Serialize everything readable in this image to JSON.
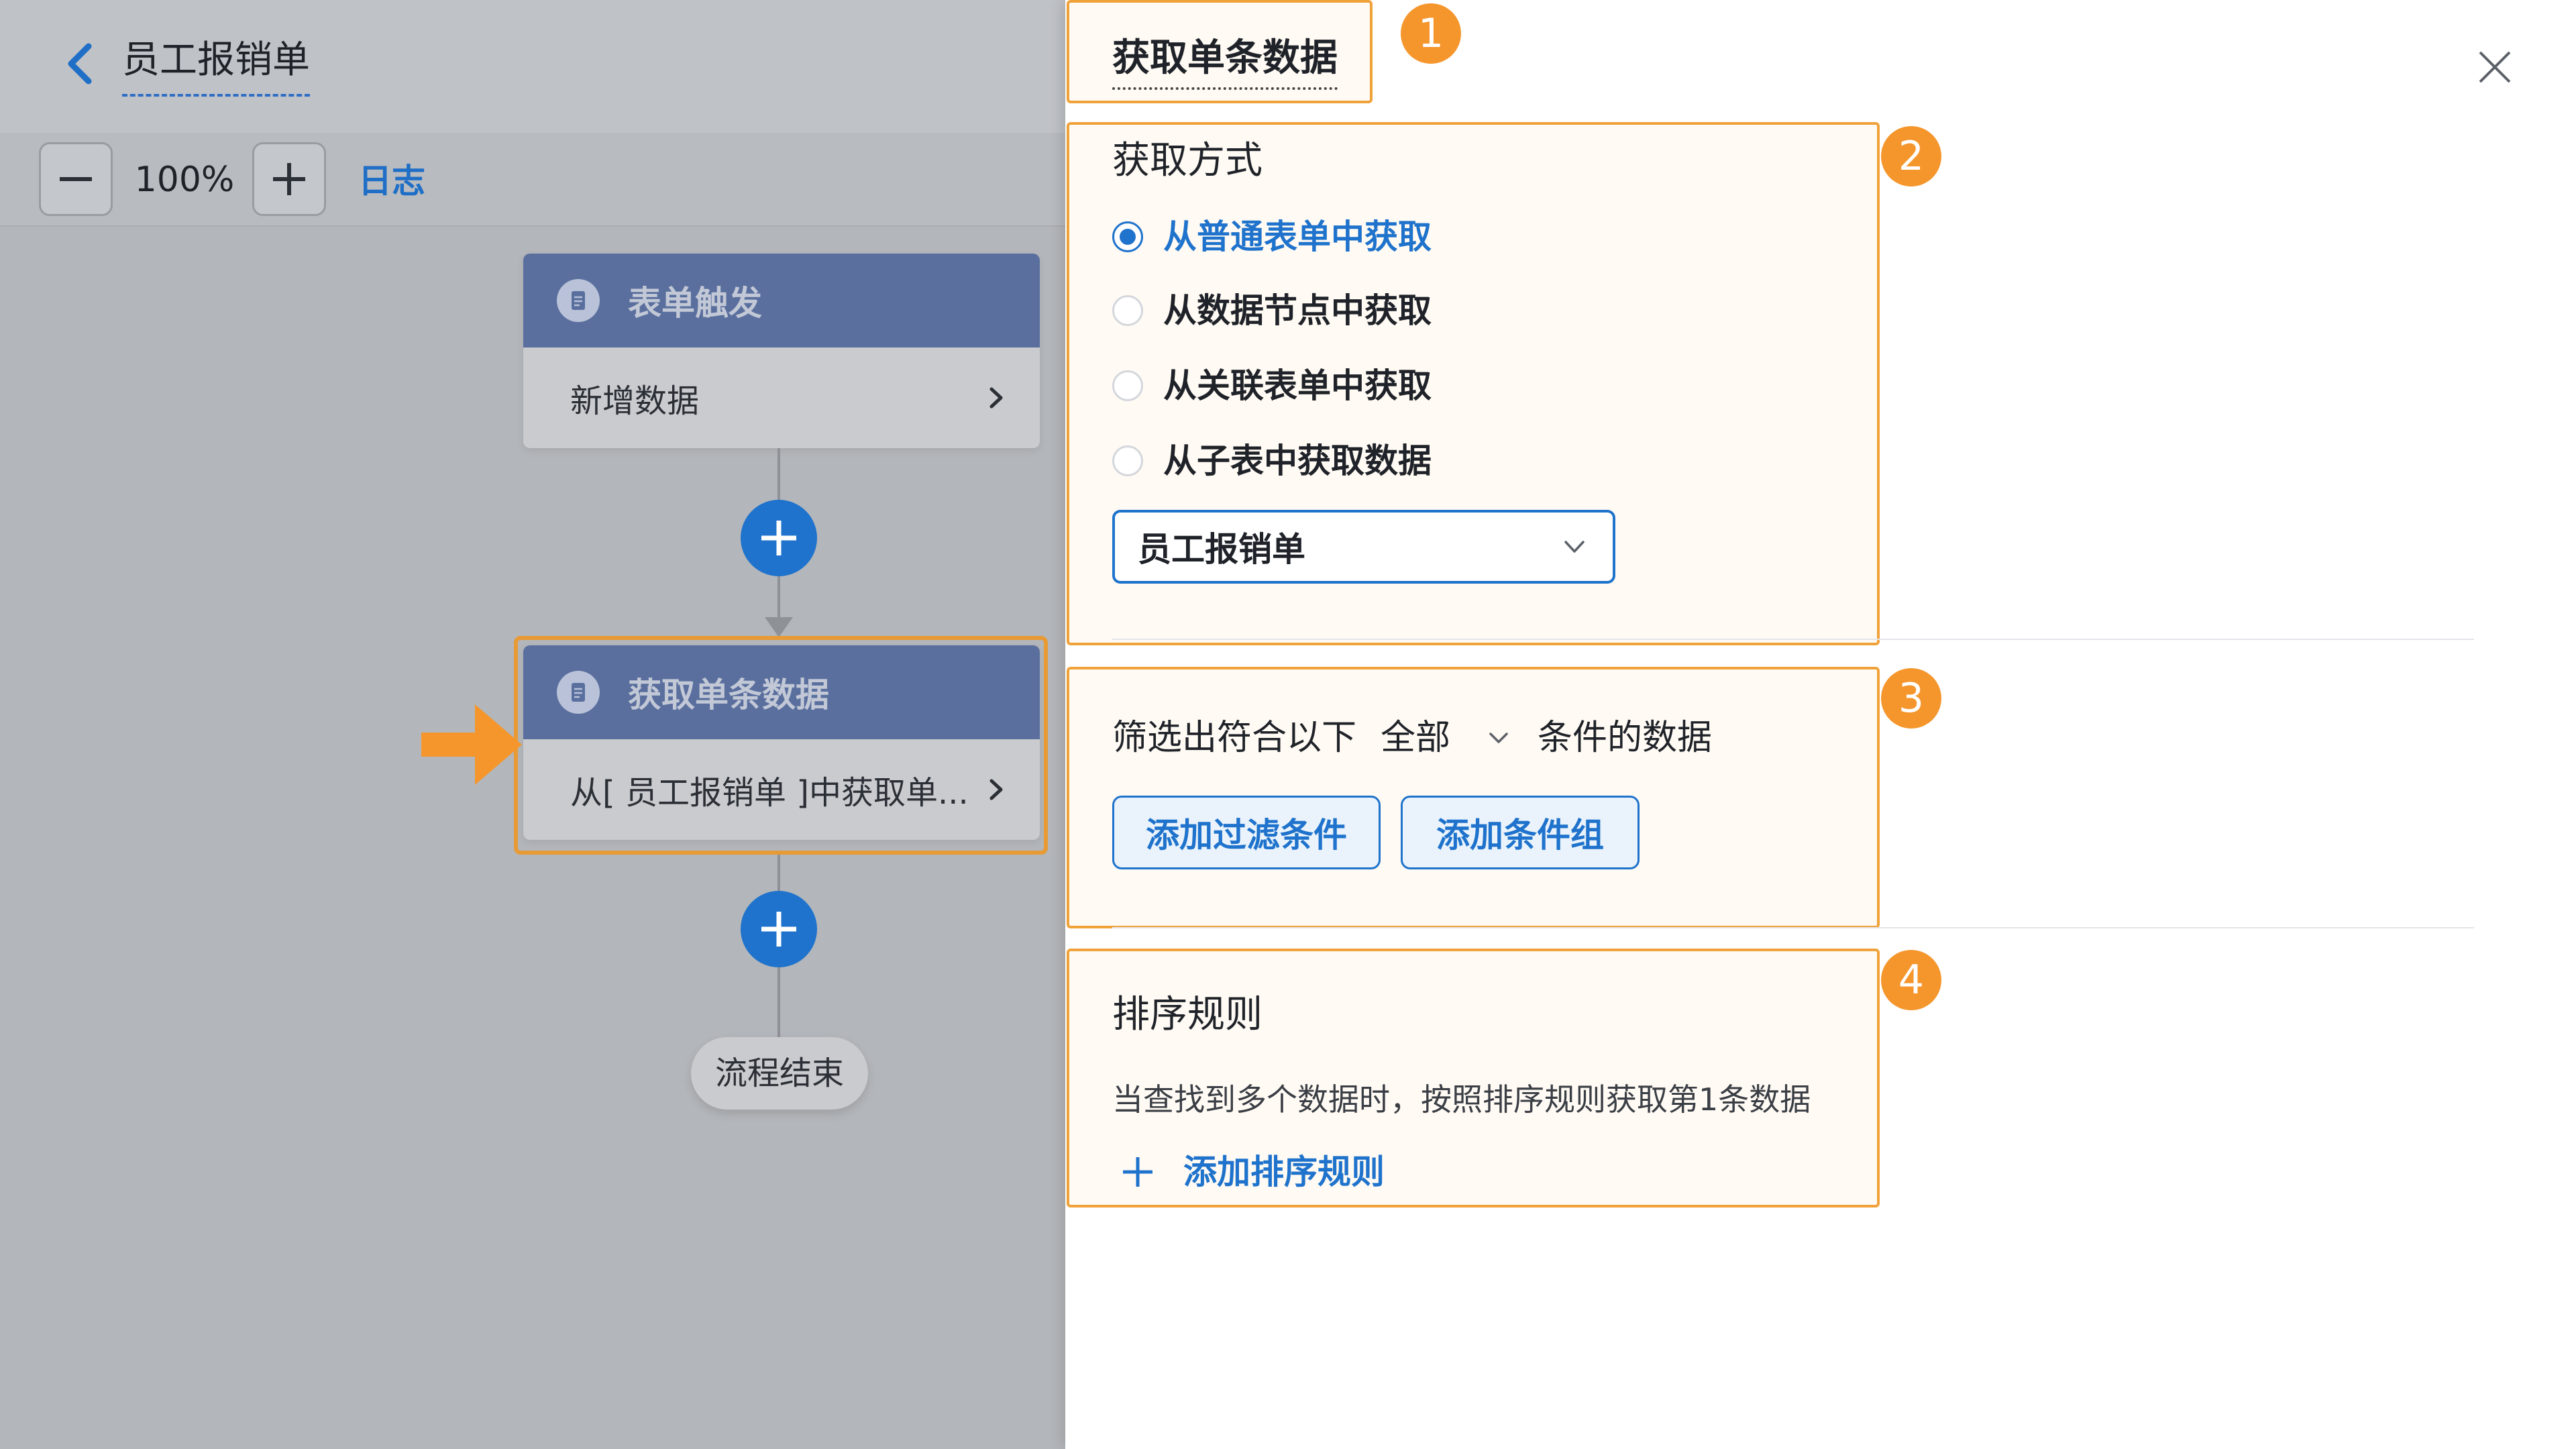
{
  "header": {
    "title": "员工报销单"
  },
  "toolbar": {
    "zoom_level": "100%",
    "log_label": "日志"
  },
  "flow": {
    "trigger_node": {
      "title": "表单触发",
      "body": "新增数据"
    },
    "getone_node": {
      "title": "获取单条数据",
      "body": "从[ 员工报销单 ]中获取单..."
    },
    "end_node": {
      "label": "流程结束"
    }
  },
  "panel": {
    "title": "获取单条数据",
    "method_label": "获取方式",
    "methods": [
      {
        "label": "从普通表单中获取",
        "selected": true
      },
      {
        "label": "从数据节点中获取",
        "selected": false
      },
      {
        "label": "从关联表单中获取",
        "selected": false
      },
      {
        "label": "从子表中获取数据",
        "selected": false
      }
    ],
    "form_select": {
      "value": "员工报销单"
    },
    "filter": {
      "prefix": "筛选出符合以下",
      "scope": "全部",
      "suffix": "条件的数据",
      "add_filter_label": "添加过滤条件",
      "add_group_label": "添加条件组"
    },
    "sort": {
      "label": "排序规则",
      "description": "当查找到多个数据时，按照排序规则获取第1条数据",
      "add_label": "添加排序规则"
    }
  },
  "annotations": {
    "badges": [
      "1",
      "2",
      "3",
      "4"
    ]
  },
  "colors": {
    "accent": "#1f73cc",
    "highlight": "#f0a23a",
    "badge": "#f5962d",
    "node_header": "#5a6f9e"
  }
}
